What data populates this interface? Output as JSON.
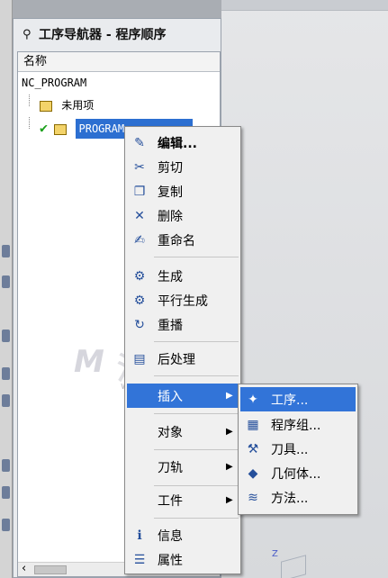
{
  "navigator": {
    "title": "工序导航器 - 程序顺序",
    "column_header": "名称",
    "tree": [
      {
        "label": "NC_PROGRAM",
        "level": 0
      },
      {
        "label": "未用项",
        "level": 1
      },
      {
        "label": "PROGRAM",
        "level": 1,
        "selected": true,
        "status": "checked"
      }
    ]
  },
  "context_menu": {
    "items": [
      {
        "label": "编辑...",
        "icon": "edit-icon",
        "bold": true
      },
      {
        "label": "剪切",
        "icon": "cut-icon"
      },
      {
        "label": "复制",
        "icon": "copy-icon"
      },
      {
        "label": "删除",
        "icon": "delete-icon"
      },
      {
        "label": "重命名",
        "icon": "rename-icon"
      },
      {
        "label": "生成",
        "icon": "generate-icon"
      },
      {
        "label": "平行生成",
        "icon": "parallel-generate-icon"
      },
      {
        "label": "重播",
        "icon": "replay-icon"
      },
      {
        "label": "后处理",
        "icon": "postprocess-icon"
      },
      {
        "label": "插入",
        "submenu": true,
        "active": true
      },
      {
        "label": "对象",
        "submenu": true
      },
      {
        "label": "刀轨",
        "submenu": true
      },
      {
        "label": "工件",
        "submenu": true
      },
      {
        "label": "信息",
        "icon": "info-icon"
      },
      {
        "label": "属性",
        "icon": "properties-icon"
      }
    ]
  },
  "submenu": {
    "items": [
      {
        "label": "工序...",
        "icon": "operation-icon",
        "active": true
      },
      {
        "label": "程序组...",
        "icon": "program-group-icon"
      },
      {
        "label": "刀具...",
        "icon": "tool-icon"
      },
      {
        "label": "几何体...",
        "icon": "geometry-icon"
      },
      {
        "label": "方法...",
        "icon": "method-icon"
      }
    ]
  },
  "watermark": {
    "text": "沐风网",
    "url": "www.mfcad.com"
  },
  "axis_label": "Z"
}
